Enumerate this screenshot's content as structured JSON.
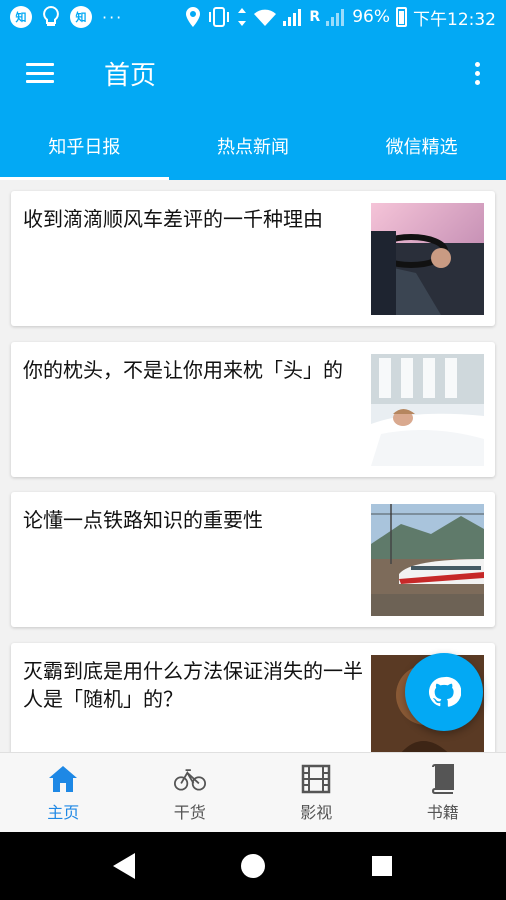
{
  "status_bar": {
    "left_badges": [
      "知",
      "知"
    ],
    "dots": "···",
    "roaming": "R",
    "battery_pct": "96%",
    "time": "下午12:32"
  },
  "app_bar": {
    "title": "首页"
  },
  "tabs": [
    {
      "label": "知乎日报",
      "active": true
    },
    {
      "label": "热点新闻",
      "active": false
    },
    {
      "label": "微信精选",
      "active": false
    }
  ],
  "articles": [
    {
      "title": "收到滴滴顺风车差评的一千种理由"
    },
    {
      "title": "你的枕头，不是让你用来枕「头」的"
    },
    {
      "title": "论懂一点铁路知识的重要性"
    },
    {
      "title": "灭霸到底是用什么方法保证消失的一半人是「随机」的？"
    }
  ],
  "bottom_nav": [
    {
      "label": "主页",
      "icon": "home-icon",
      "active": true
    },
    {
      "label": "干货",
      "icon": "bicycle-icon",
      "active": false
    },
    {
      "label": "影视",
      "icon": "film-icon",
      "active": false
    },
    {
      "label": "书籍",
      "icon": "book-icon",
      "active": false
    }
  ],
  "colors": {
    "primary": "#03a9f4",
    "nav_active": "#1e88e5"
  }
}
